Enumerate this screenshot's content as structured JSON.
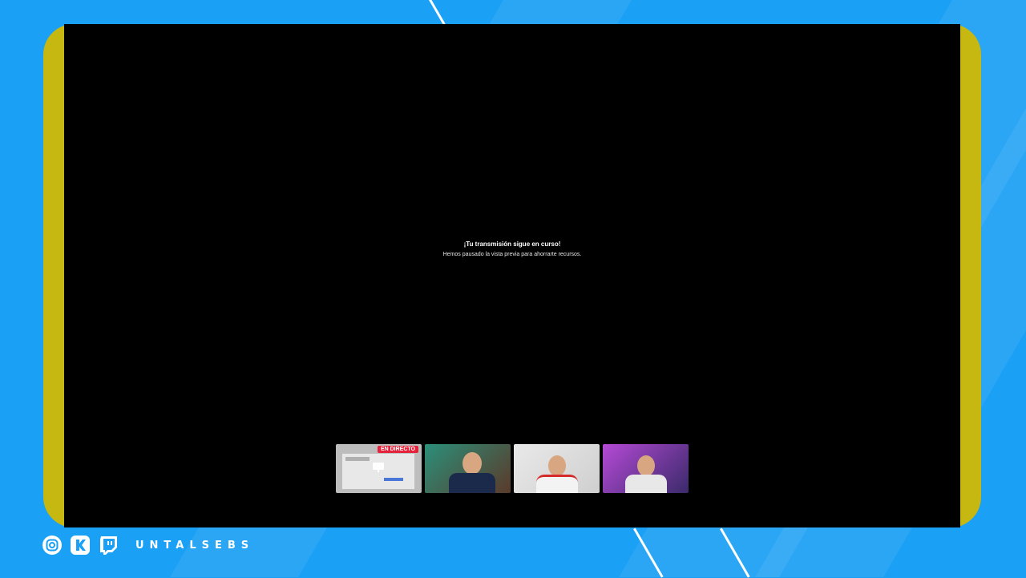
{
  "stream": {
    "title": "¡Tu transmisión sigue en curso!",
    "subtitle": "Hemos pausado la vista previa para ahorrarte recursos."
  },
  "thumbnails": [
    {
      "type": "screen-share",
      "badge": "EN DIRECTO"
    },
    {
      "type": "camera"
    },
    {
      "type": "camera"
    },
    {
      "type": "camera"
    }
  ],
  "footer": {
    "icons": [
      "instagram-icon",
      "kick-icon",
      "twitch-icon"
    ],
    "handle": "UNTALSEBS"
  },
  "colors": {
    "background": "#1aa0f5",
    "frame": "#c6b711",
    "live": "#e5223a"
  }
}
